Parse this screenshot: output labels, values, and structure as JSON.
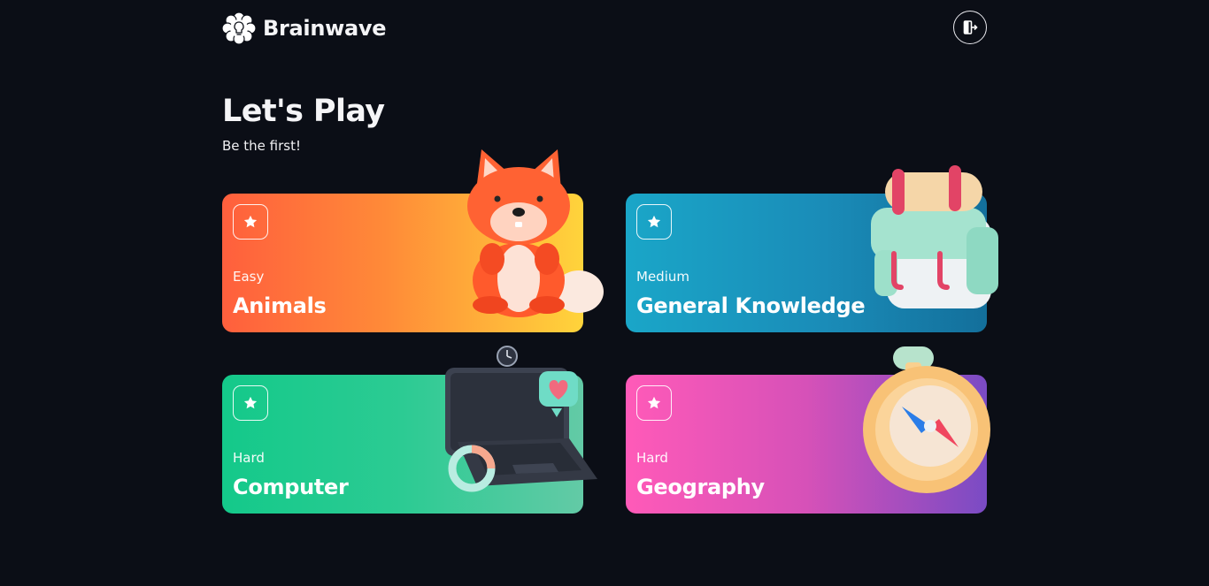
{
  "app": {
    "name": "Brainwave",
    "logo_icon": "brain-bulb-icon",
    "logout_icon": "logout-icon"
  },
  "hero": {
    "title": "Let's Play",
    "subtitle": "Be the first!"
  },
  "quizzes": [
    {
      "level": "Easy",
      "topic": "Animals",
      "icon": "star-icon",
      "illustration": "fox-illustration"
    },
    {
      "level": "Medium",
      "topic": "General Knowledge",
      "icon": "star-icon",
      "illustration": "backpack-illustration"
    },
    {
      "level": "Hard",
      "topic": "Computer",
      "icon": "star-icon",
      "illustration": "laptop-illustration"
    },
    {
      "level": "Hard",
      "topic": "Geography",
      "icon": "star-icon",
      "illustration": "compass-illustration"
    }
  ],
  "colors": {
    "background": "#0b0e16",
    "animals": [
      "#ff5f3d",
      "#ffd43b"
    ],
    "general_knowledge": [
      "#1aa6c8",
      "#136f9b"
    ],
    "computer": [
      "#14c98a",
      "#63caa6"
    ],
    "geography": [
      "#ff5ab8",
      "#7a4bc4"
    ]
  }
}
